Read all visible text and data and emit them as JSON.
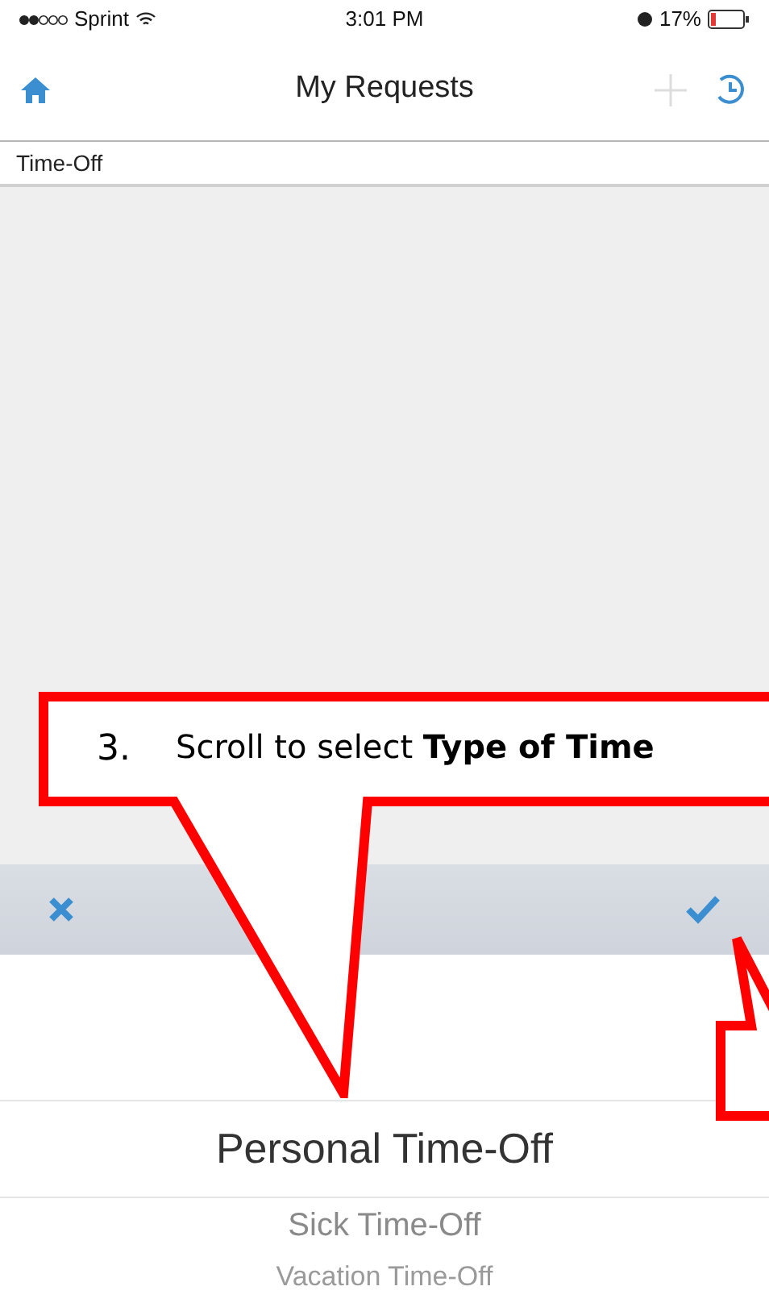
{
  "status_bar": {
    "carrier": "Sprint",
    "time": "3:01 PM",
    "battery": "17%"
  },
  "nav_bar": {
    "title": "My Requests"
  },
  "section": {
    "label": "Time-Off"
  },
  "picker": {
    "options": [
      {
        "label": "Personal Time-Off",
        "selected": true
      },
      {
        "label": "Sick Time-Off",
        "selected": false
      },
      {
        "label": "Vacation Time-Off",
        "selected": false
      }
    ]
  },
  "annotation": {
    "step": "3.",
    "text": "Scroll to select **Type of Time**"
  }
}
